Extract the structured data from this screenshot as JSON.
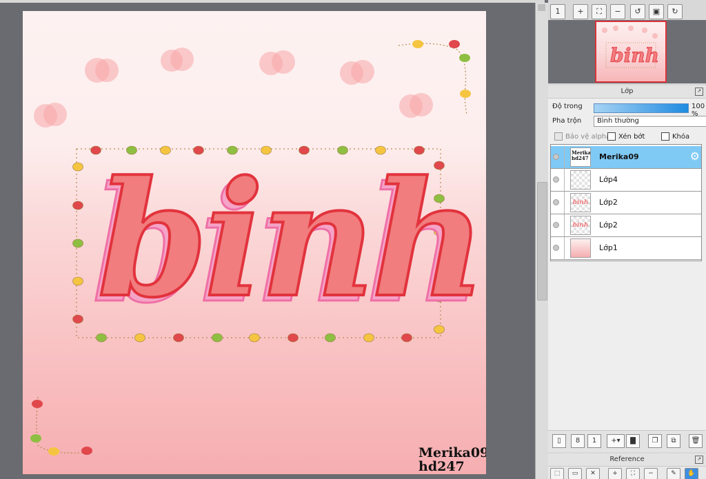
{
  "canvas": {
    "artwork_text": "binh",
    "watermark_line1": "Merika09",
    "watermark_line2": "hd247"
  },
  "navigator": {
    "tools": [
      {
        "name": "actual-size-icon",
        "glyph": "1"
      },
      {
        "name": "zoom-in-icon",
        "glyph": "+"
      },
      {
        "name": "fit-icon",
        "glyph": "⛶"
      },
      {
        "name": "zoom-out-icon",
        "glyph": "−"
      },
      {
        "name": "rotate-left-icon",
        "glyph": "↺"
      },
      {
        "name": "fit-window-icon",
        "glyph": "▣"
      },
      {
        "name": "rotate-right-icon",
        "glyph": "↻"
      }
    ],
    "thumbnail_text": "binh"
  },
  "layer_panel": {
    "title": "Lớp",
    "opacity_label": "Độ trong",
    "opacity_value": "100 %",
    "opacity_fraction": 1.0,
    "blend_label": "Pha trộn",
    "blend_value": "Bình thường",
    "protect_alpha_label": "Bảo vệ alpha",
    "clipping_label": "Xén bớt",
    "lock_label": "Khóa",
    "layers": [
      {
        "name": "Merika09",
        "thumb_text_1": "Merika09",
        "thumb_text_2": "hd247",
        "selected": true
      },
      {
        "name": "Lớp4",
        "selected": false
      },
      {
        "name": "Lớp2",
        "thumb_text": "binh",
        "selected": false
      },
      {
        "name": "Lớp2",
        "thumb_text": "binh",
        "selected": false
      },
      {
        "name": "Lớp1",
        "selected": false
      }
    ],
    "bottom_tools": [
      {
        "name": "new-layer-icon",
        "glyph": "▯"
      },
      {
        "name": "new-layer-8bit-icon",
        "glyph": "8"
      },
      {
        "name": "new-layer-1bit-icon",
        "glyph": "1"
      },
      {
        "name": "add-layer-menu-icon",
        "glyph": "+▾"
      },
      {
        "name": "new-folder-icon",
        "glyph": "▇"
      },
      {
        "name": "duplicate-layer-icon",
        "glyph": "❐"
      },
      {
        "name": "merge-down-icon",
        "glyph": "⧉"
      },
      {
        "name": "delete-layer-icon",
        "glyph": "🗑"
      }
    ]
  },
  "reference_panel": {
    "title": "Reference",
    "tools": [
      {
        "name": "open-image-icon",
        "glyph": "⬚"
      },
      {
        "name": "open-folder-icon",
        "glyph": "▭"
      },
      {
        "name": "close-icon",
        "glyph": "✕"
      },
      {
        "name": "zoom-in-icon",
        "glyph": "+"
      },
      {
        "name": "fit-icon",
        "glyph": "⛶"
      },
      {
        "name": "zoom-out-icon",
        "glyph": "−"
      },
      {
        "name": "eyedropper-icon",
        "glyph": "✎"
      },
      {
        "name": "hand-icon",
        "glyph": "✋"
      }
    ]
  },
  "colors": {
    "selected_layer": "#7fc9f5",
    "lettering_fill": "#f17d7e",
    "lettering_outline": "#e2333d",
    "lettering_shadow": "#f5a3c7"
  }
}
